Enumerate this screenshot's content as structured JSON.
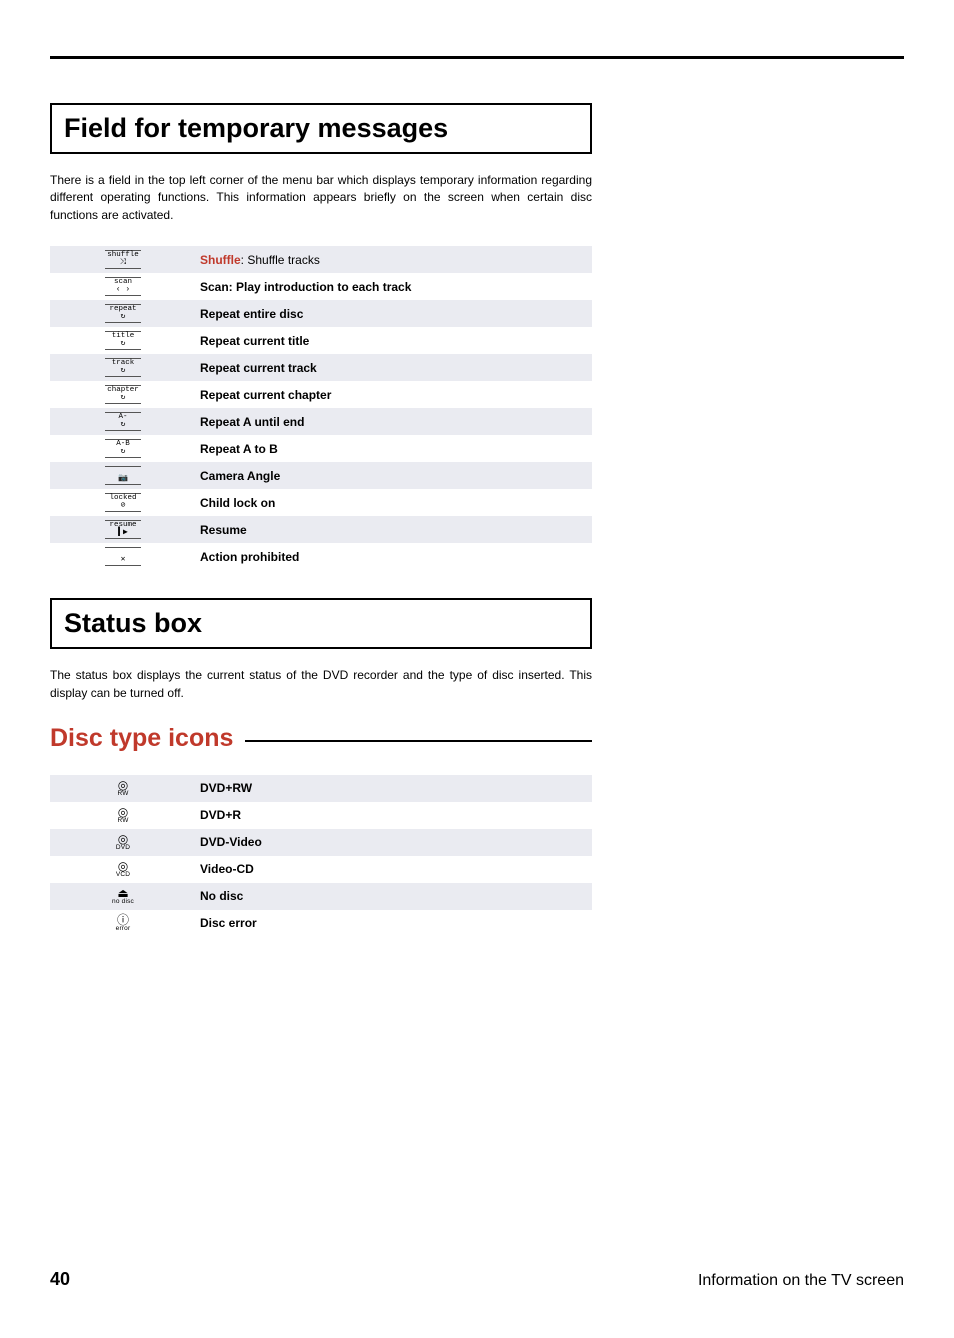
{
  "sections": {
    "s1": {
      "title": "Field for temporary messages",
      "intro": "There is a field in the top left corner of the menu bar which displays temporary information regarding different operating functions. This information appears briefly on the screen when certain disc functions are activated."
    },
    "s2": {
      "title": "Status box",
      "intro": "The status box displays the current status of the DVD recorder and the type of disc inserted. This display can be turned off."
    },
    "s3": {
      "title": "Disc type icons"
    }
  },
  "messages": [
    {
      "icon_top": "shuffle",
      "icon_sym": "⤨",
      "bold": "Shuffle",
      "text": ": Shuffle tracks",
      "shade": true,
      "red": true
    },
    {
      "icon_top": "scan",
      "icon_sym": "‹ ›",
      "bold": "Scan: Play introduction to each track",
      "text": "",
      "shade": false
    },
    {
      "icon_top": "repeat",
      "icon_sym": "↻",
      "bold": "Repeat entire disc",
      "text": "",
      "shade": true
    },
    {
      "icon_top": "title",
      "icon_sym": "↻",
      "bold": "Repeat current title",
      "text": "",
      "shade": false
    },
    {
      "icon_top": "track",
      "icon_sym": "↻",
      "bold": "Repeat current track",
      "text": "",
      "shade": true
    },
    {
      "icon_top": "chapter",
      "icon_sym": "↻",
      "bold": "Repeat current chapter",
      "text": "",
      "shade": false
    },
    {
      "icon_top": "A-",
      "icon_sym": "↻",
      "bold": "Repeat A until end",
      "text": "",
      "shade": true
    },
    {
      "icon_top": "A-B",
      "icon_sym": "↻",
      "bold": "Repeat A to B",
      "text": "",
      "shade": false
    },
    {
      "icon_top": "",
      "icon_sym": "📷",
      "bold": "Camera Angle",
      "text": "",
      "shade": true
    },
    {
      "icon_top": "locked",
      "icon_sym": "⊘",
      "bold": "Child lock on",
      "text": "",
      "shade": false
    },
    {
      "icon_top": "resume",
      "icon_sym": "▍▶",
      "bold": "Resume",
      "text": "",
      "shade": true
    },
    {
      "icon_top": "",
      "icon_sym": "✕",
      "bold": "Action prohibited",
      "text": "",
      "shade": false
    }
  ],
  "disc_types": [
    {
      "circ": "◎",
      "lbl": "RW",
      "text": "DVD+RW",
      "shade": true
    },
    {
      "circ": "◎",
      "lbl": "RW",
      "text": "DVD+R",
      "shade": false
    },
    {
      "circ": "◎",
      "lbl": "DVD",
      "text": "DVD-Video",
      "shade": true
    },
    {
      "circ": "◎",
      "lbl": "VCD",
      "text": "Video-CD",
      "shade": false
    },
    {
      "circ": "⏏",
      "lbl": "no disc",
      "text": "No disc",
      "shade": true
    },
    {
      "circ": "ⓘ",
      "lbl": "error",
      "text": "Disc error",
      "shade": false
    }
  ],
  "footer": {
    "page": "40",
    "label": "Information on the TV screen"
  }
}
